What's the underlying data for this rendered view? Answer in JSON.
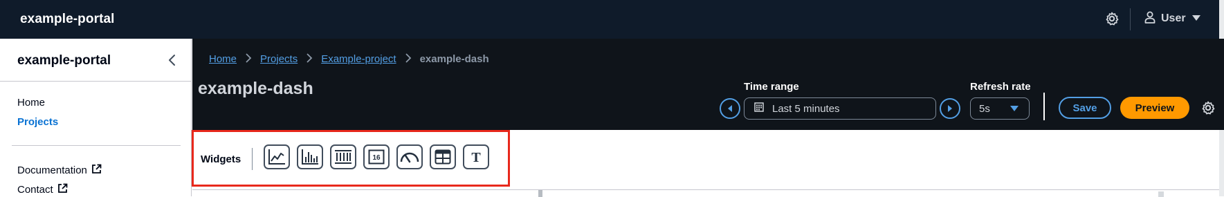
{
  "topbar": {
    "app_title": "example-portal",
    "user_label": "User"
  },
  "sidebar": {
    "title": "example-portal",
    "nav": [
      {
        "label": "Home",
        "active": false
      },
      {
        "label": "Projects",
        "active": true
      }
    ],
    "links": [
      {
        "label": "Documentation"
      },
      {
        "label": "Contact"
      }
    ]
  },
  "breadcrumb": {
    "items": [
      "Home",
      "Projects",
      "Example-project"
    ],
    "current": "example-dash"
  },
  "page_title": "example-dash",
  "controls": {
    "time_range_label": "Time range",
    "time_range_value": "Last 5 minutes",
    "refresh_rate_label": "Refresh rate",
    "refresh_rate_value": "5s",
    "save_label": "Save",
    "preview_label": "Preview"
  },
  "widgets": {
    "label": "Widgets",
    "items": [
      {
        "icon": "line-chart-icon"
      },
      {
        "icon": "bar-chart-icon"
      },
      {
        "icon": "status-timeline-icon"
      },
      {
        "icon": "kpi-icon",
        "text": "16"
      },
      {
        "icon": "gauge-icon"
      },
      {
        "icon": "table-icon"
      },
      {
        "icon": "text-icon",
        "text": "T"
      }
    ]
  },
  "colors": {
    "topbar_bg": "#0f1b2a",
    "header_bg": "#0f141a",
    "link_blue": "#539fe5",
    "active_nav": "#0972d3",
    "preview_orange": "#ff9900",
    "highlight_red": "#e8281c"
  }
}
